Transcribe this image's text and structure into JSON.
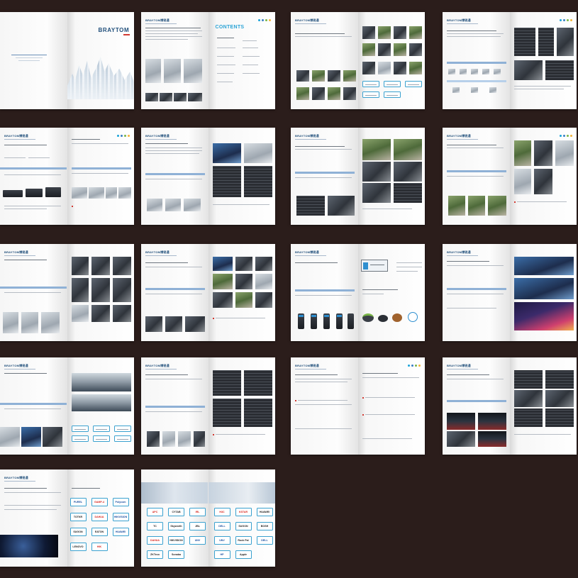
{
  "catalog": {
    "brand_name": "BRAYTOM",
    "header_brand": "BRAYTOM博锐通",
    "contents_heading": "CONTENTS",
    "accent_colors": [
      "#1aa3d9",
      "#3a7fc4",
      "#7ab648",
      "#f4b43a"
    ],
    "brand_color": "#1f4e7a",
    "background_color": "#2b1d1b"
  },
  "partner_logos_page_20": [
    "PUREL",
    "GAMP-4",
    "Polycom",
    "TOTKR",
    "DAHUA",
    "HIKVISION",
    "SUGON",
    "EATON",
    "HUAWEI",
    "LENOVO",
    "HIK"
  ],
  "partner_logos_page_21": [
    "APC",
    "CYTAB",
    "IRL",
    "H3C",
    "KSTAR",
    "HUAWEI",
    "TC",
    "Skyworth",
    "JBL",
    "DELL",
    "SUGON",
    "BOSH",
    "DAHUA",
    "HIKVISION",
    "ZKTeco",
    "Sonaba",
    "UNV",
    "Rock Pal",
    "DELL",
    "HP",
    "Apple"
  ]
}
